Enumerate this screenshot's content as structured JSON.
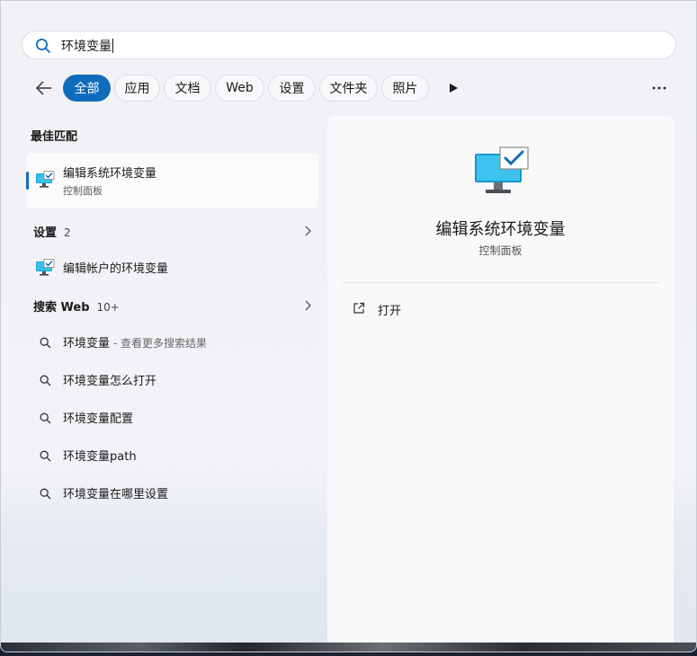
{
  "search": {
    "query": "环境变量"
  },
  "filters": [
    {
      "label": "全部",
      "active": true
    },
    {
      "label": "应用"
    },
    {
      "label": "文档"
    },
    {
      "label": "Web"
    },
    {
      "label": "设置"
    },
    {
      "label": "文件夹"
    },
    {
      "label": "照片"
    }
  ],
  "best_match": {
    "heading": "最佳匹配",
    "title": "编辑系统环境变量",
    "subtitle": "控制面板"
  },
  "settings_section": {
    "heading": "设置",
    "count": "2",
    "items": [
      "编辑帐户的环境变量"
    ]
  },
  "web_section": {
    "heading": "搜索 Web",
    "count": "10+",
    "items": [
      {
        "text": "环境变量",
        "hint": " - 查看更多搜索结果"
      },
      {
        "text": "环境变量怎么打开"
      },
      {
        "text": "环境变量配置"
      },
      {
        "text": "环境变量path"
      },
      {
        "text": "环境变量在哪里设置"
      }
    ]
  },
  "preview": {
    "title": "编辑系统环境变量",
    "subtitle": "控制面板",
    "action_open": "打开"
  },
  "colors": {
    "accent": "#0f6cbd",
    "check": "#0f6cbd"
  }
}
